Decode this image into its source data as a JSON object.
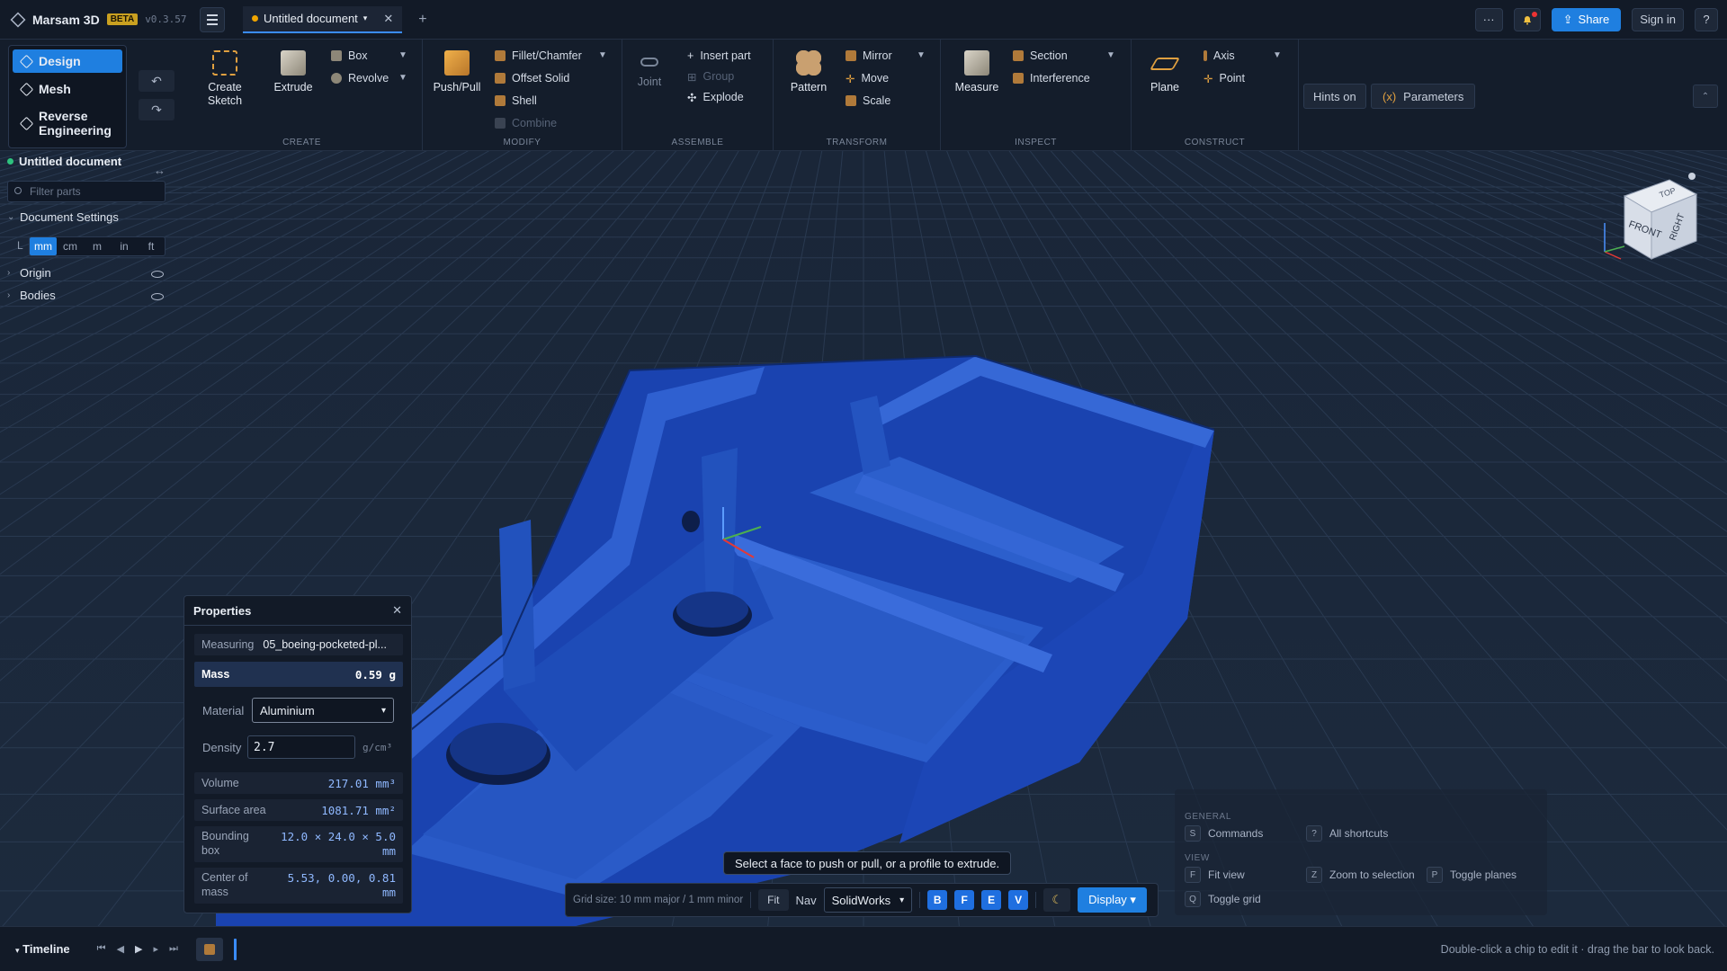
{
  "app": {
    "name": "Marsam 3D",
    "badge": "BETA",
    "version": "v0.3.57"
  },
  "tabs": {
    "active_tab": "Untitled document",
    "close": "✕",
    "new": "+"
  },
  "top_right": {
    "more": "···",
    "share": "Share",
    "sign_in": "Sign in",
    "help": "?"
  },
  "modes": [
    "Design",
    "Mesh",
    "Reverse Engineering"
  ],
  "ribbon": {
    "create": {
      "label": "CREATE",
      "create_sketch": "Create Sketch",
      "extrude": "Extrude",
      "box": "Box",
      "revolve": "Revolve"
    },
    "modify": {
      "label": "MODIFY",
      "push_pull": "Push/Pull",
      "fillet": "Fillet/Chamfer",
      "offset_solid": "Offset Solid",
      "shell": "Shell",
      "combine": "Combine"
    },
    "assemble": {
      "label": "ASSEMBLE",
      "joint": "Joint",
      "insert_part": "Insert part",
      "group": "Group",
      "explode": "Explode"
    },
    "transform": {
      "label": "TRANSFORM",
      "pattern": "Pattern",
      "mirror": "Mirror",
      "move": "Move",
      "scale": "Scale"
    },
    "inspect": {
      "label": "INSPECT",
      "measure": "Measure",
      "section": "Section",
      "interference": "Interference"
    },
    "construct": {
      "label": "CONSTRUCT",
      "plane": "Plane",
      "axis": "Axis",
      "point": "Point"
    },
    "hints": "Hints on",
    "parameters": "Parameters"
  },
  "left_panel": {
    "doc_title": "Untitled document",
    "filter_placeholder": "Filter parts",
    "doc_settings": "Document Settings",
    "units_label": "L",
    "units": [
      "mm",
      "cm",
      "m",
      "in",
      "ft"
    ],
    "active_unit": "mm",
    "tree": [
      "Origin",
      "Bodies"
    ]
  },
  "properties": {
    "title": "Properties",
    "measuring_label": "Measuring",
    "measuring_value": "05_boeing-pocketed-pl...",
    "mass_label": "Mass",
    "mass_value": "0.59 g",
    "material_label": "Material",
    "material_value": "Aluminium",
    "density_label": "Density",
    "density_value": "2.7",
    "density_unit": "g/cm³",
    "volume_label": "Volume",
    "volume_value": "217.01 mm³",
    "surface_label": "Surface area",
    "surface_value": "1081.71 mm²",
    "bbox_label_1": "Bounding",
    "bbox_label_2": "box",
    "bbox_value_1": "12.0 × 24.0 × 5.0",
    "bbox_value_2": "mm",
    "com_label_1": "Center of",
    "com_label_2": "mass",
    "com_value_1": "5.53, 0.00, 0.81",
    "com_value_2": "mm"
  },
  "tooltip": "Select a face to push or pull, or a profile to extrude.",
  "bottom_bar": {
    "grid_size": "Grid size: 10 mm major / 1 mm minor",
    "fit": "Fit",
    "nav_label": "Nav",
    "nav_value": "SolidWorks",
    "view_buttons": [
      "B",
      "F",
      "E",
      "V"
    ],
    "display": "Display ▾"
  },
  "shortcuts": {
    "general_head": "GENERAL",
    "view_head": "VIEW",
    "items": [
      {
        "key": "S",
        "label": "Commands"
      },
      {
        "key": "?",
        "label": "All shortcuts"
      },
      {
        "key": "F",
        "label": "Fit view"
      },
      {
        "key": "Z",
        "label": "Zoom to selection"
      },
      {
        "key": "P",
        "label": "Toggle planes"
      },
      {
        "key": "Q",
        "label": "Toggle grid"
      }
    ]
  },
  "navcube": {
    "top": "TOP",
    "front": "FRONT",
    "right": "RIGHT"
  },
  "timeline": {
    "title": "Timeline",
    "hint": "Double-click a chip to edit it · drag the bar to look back."
  },
  "colors": {
    "accent": "#1f7fe0",
    "model": "#1f49b8",
    "background": "#16202f"
  }
}
